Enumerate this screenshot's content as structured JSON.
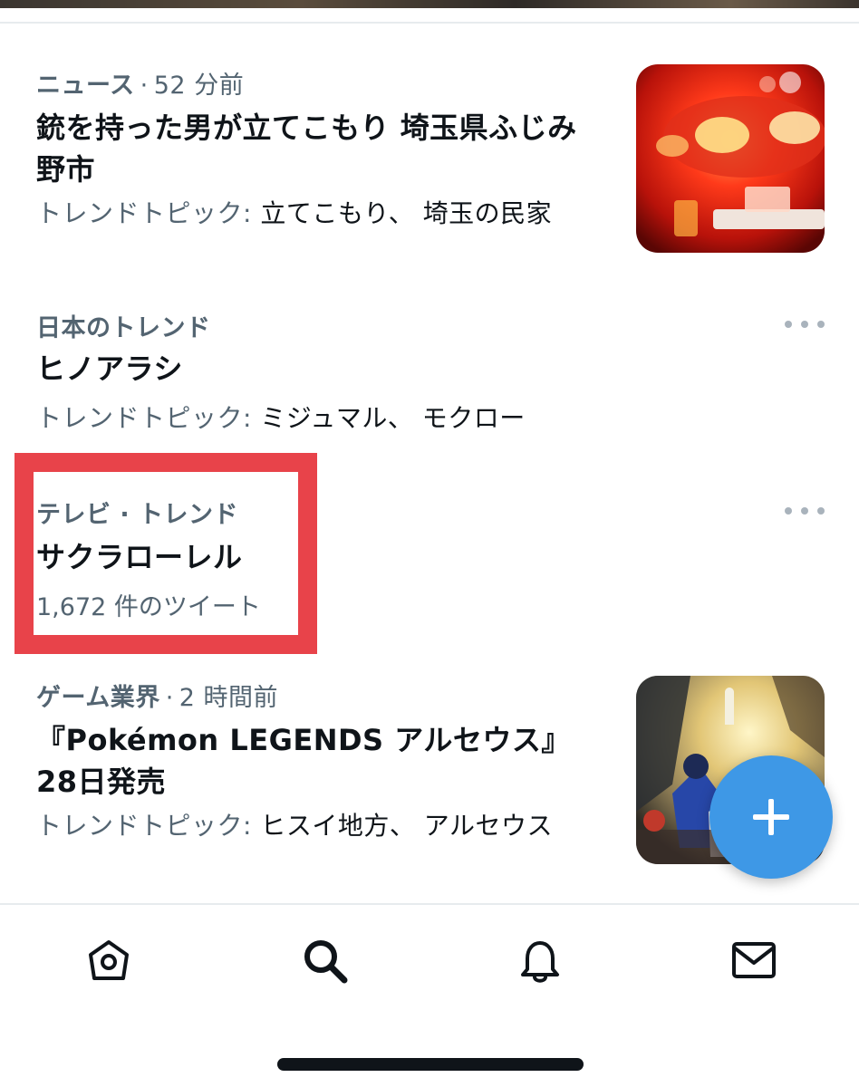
{
  "trends": [
    {
      "category": "ニュース",
      "time": "52 分前",
      "title_line1": "銃を持った男が立てこもり 埼玉県ふじみ",
      "title_line2": "野市",
      "topics_label": "トレンドトピック:",
      "topics": "立てこもり、 埼玉の民家",
      "thumbnail": "police-siren-image"
    },
    {
      "category": "日本のトレンド",
      "title": "ヒノアラシ",
      "topics_label": "トレンドトピック:",
      "topics": "ミジュマル、 モクロー"
    },
    {
      "category": "テレビ · トレンド",
      "title": "サクラローレル",
      "count": "1,672 件のツイート"
    },
    {
      "category": "ゲーム業界",
      "time": "2 時間前",
      "title_line1": "『Pokémon LEGENDS アルセウス』",
      "title_line2": "28日発売",
      "topics_label": "トレンドトピック:",
      "topics": "ヒスイ地方、 アルセウス",
      "thumbnail": "pokemon-legends-artwork"
    }
  ],
  "separator": "·",
  "fab_icon": "plus-icon",
  "tabbar": [
    "home-icon",
    "search-icon",
    "bell-icon",
    "mail-icon"
  ],
  "colors": {
    "accent": "#3e98e6",
    "highlight": "#e8434a",
    "secondary_text": "#536471",
    "primary_text": "#0f1419"
  }
}
